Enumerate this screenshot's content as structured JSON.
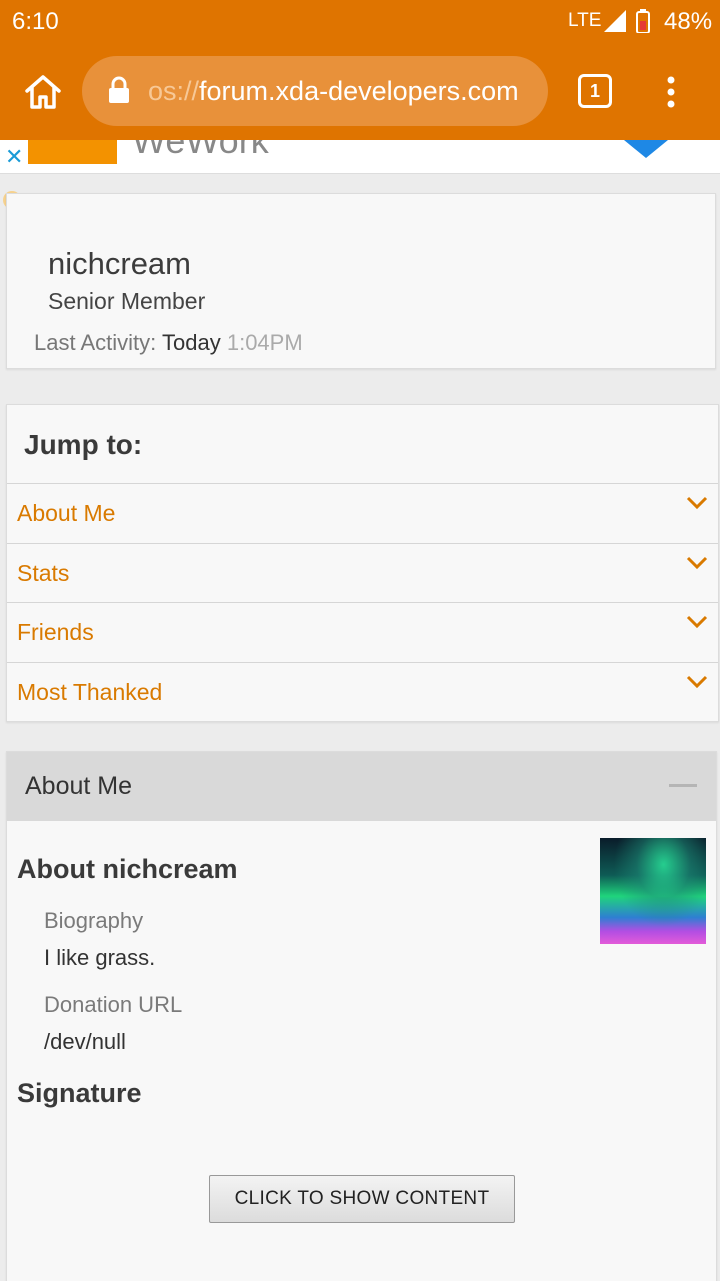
{
  "status_bar": {
    "time": "6:10",
    "network": "LTE",
    "battery": "48%"
  },
  "browser": {
    "url_prefix": "os://",
    "url_domain": "forum.xda-developers.com",
    "tab_count": "1"
  },
  "ad": {
    "text": "WeWork"
  },
  "profile": {
    "username": "nichcream",
    "rank": "Senior Member",
    "last_activity_label": "Last Activity:",
    "last_activity_day": "Today",
    "last_activity_time": "1:04PM"
  },
  "jump": {
    "title": "Jump to:",
    "items": [
      {
        "label": "About Me"
      },
      {
        "label": "Stats"
      },
      {
        "label": "Friends"
      },
      {
        "label": "Most Thanked"
      }
    ]
  },
  "about": {
    "header": "About Me",
    "name_heading": "About nichcream",
    "biography_label": "Biography",
    "biography_value": "I like grass.",
    "donation_label": "Donation URL",
    "donation_value": "/dev/null",
    "signature_heading": "Signature",
    "show_button": "CLICK TO SHOW CONTENT"
  },
  "colors": {
    "accent": "#df7400",
    "link": "#d97a00"
  }
}
